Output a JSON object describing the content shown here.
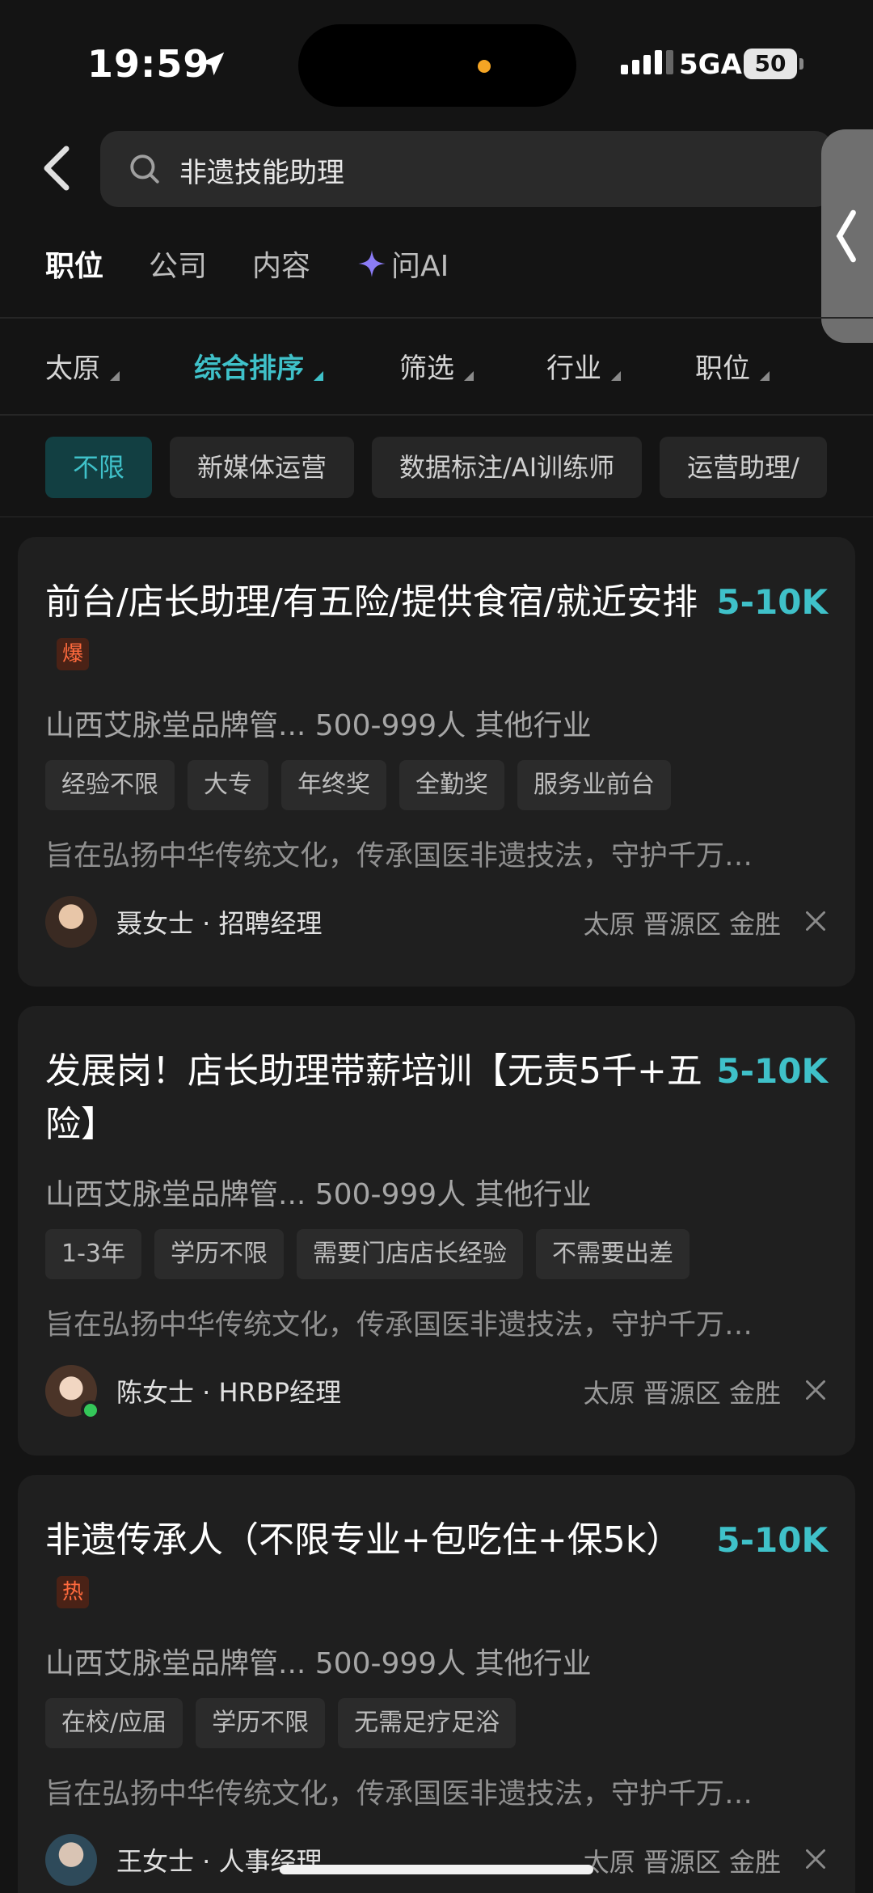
{
  "status_bar": {
    "time": "19:59",
    "network": "5GA",
    "battery": "50"
  },
  "search": {
    "query": "非遗技能助理"
  },
  "tabs": [
    {
      "label": "职位",
      "active": true
    },
    {
      "label": "公司",
      "active": false
    },
    {
      "label": "内容",
      "active": false
    },
    {
      "label": "问AI",
      "active": false
    }
  ],
  "filters": [
    {
      "label": "太原",
      "active": false
    },
    {
      "label": "综合排序",
      "active": true
    },
    {
      "label": "筛选",
      "active": false
    },
    {
      "label": "行业",
      "active": false
    },
    {
      "label": "职位",
      "active": false
    }
  ],
  "chips": [
    {
      "label": "不限",
      "active": true
    },
    {
      "label": "新媒体运营",
      "active": false
    },
    {
      "label": "数据标注/AI训练师",
      "active": false
    },
    {
      "label": "运营助理/",
      "active": false
    }
  ],
  "jobs": [
    {
      "title": "前台/店长助理/有五险/提供食宿/就近安排",
      "badge": "爆",
      "salary": "5-10K",
      "company": "山西艾脉堂品牌管... 500-999人 其他行业",
      "tags": [
        "经验不限",
        "大专",
        "年终奖",
        "全勤奖",
        "服务业前台"
      ],
      "description": "旨在弘扬中华传统文化，传承国医非遗技法，守护千万…",
      "recruiter": "聂女士 · 招聘经理",
      "location": "太原 晋源区 金胜"
    },
    {
      "title": "发展岗！店长助理带薪培训【无责5千+五险】",
      "badge": "",
      "salary": "5-10K",
      "company": "山西艾脉堂品牌管... 500-999人 其他行业",
      "tags": [
        "1-3年",
        "学历不限",
        "需要门店店长经验",
        "不需要出差"
      ],
      "description": "旨在弘扬中华传统文化，传承国医非遗技法，守护千万…",
      "recruiter": "陈女士 · HRBP经理",
      "location": "太原 晋源区 金胜"
    },
    {
      "title": "非遗传承人（不限专业+包吃住+保5k）",
      "badge": "热",
      "salary": "5-10K",
      "company": "山西艾脉堂品牌管... 500-999人 其他行业",
      "tags": [
        "在校/应届",
        "学历不限",
        "无需足疗足浴"
      ],
      "description": "旨在弘扬中华传统文化，传承国医非遗技法，守护千万…",
      "recruiter": "王女士 · 人事经理",
      "location": "太原 晋源区 金胜"
    }
  ],
  "colors": {
    "accent": "#3fc1c9",
    "badge": "#ff6a3d",
    "background": "#141414",
    "card": "#1f1f1f"
  }
}
